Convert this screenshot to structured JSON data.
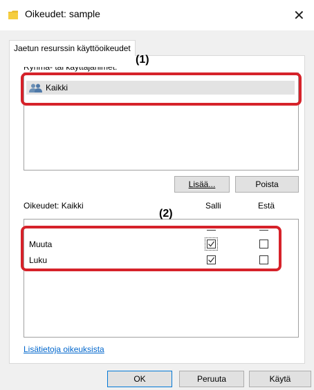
{
  "window": {
    "title": "Oikeudet: sample",
    "close_glyph": "✕"
  },
  "tab": {
    "label": "Jaetun resurssin käyttöoikeudet"
  },
  "groups": {
    "label": "Ryhmä- tai käyttäjänimet:",
    "items": [
      {
        "label": "Kaikki",
        "icon": "users-icon"
      }
    ],
    "add_label": "Lisää...",
    "remove_label": "Poista"
  },
  "permissions": {
    "label": "Oikeudet: Kaikki",
    "allow_header": "Salli",
    "deny_header": "Estä",
    "rows": [
      {
        "name": "Muuta",
        "allow": true,
        "deny": false
      },
      {
        "name": "Luku",
        "allow": true,
        "deny": false
      }
    ]
  },
  "link": {
    "label": "Lisätietoja oikeuksista"
  },
  "footer": {
    "ok_label": "OK",
    "cancel_label": "Peruuta",
    "apply_label": "Käytä"
  },
  "annotations": {
    "callout_1": "(1)",
    "callout_2": "(2)"
  },
  "colors": {
    "callout": "#d6222a",
    "link": "#0066cc",
    "folder": "#e8b92a"
  }
}
